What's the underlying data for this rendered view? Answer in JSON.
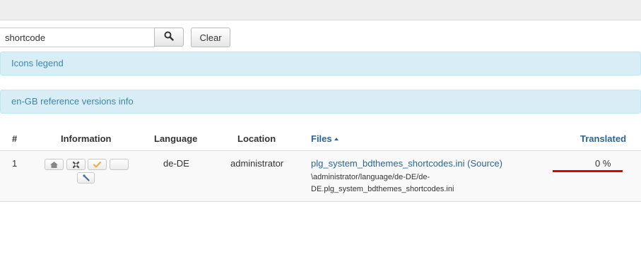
{
  "search": {
    "value": "shortcode",
    "clear_label": "Clear"
  },
  "panels": {
    "icons_legend": "Icons legend",
    "reference_info": "en-GB reference versions info"
  },
  "table": {
    "headers": {
      "number": "#",
      "information": "Information",
      "language": "Language",
      "location": "Location",
      "files": "Files",
      "translated": "Translated"
    },
    "rows": [
      {
        "number": "1",
        "language": "de-DE",
        "location": "administrator",
        "file_name": "plg_system_bdthemes_shortcodes.ini",
        "source_label": "(Source)",
        "path_line1": "\\administrator/language/de-DE/de-",
        "path_line2": "DE.plg_system_bdthemes_shortcodes.ini",
        "translated": "0 %",
        "translated_fraction": 0
      }
    ]
  },
  "icons": {
    "search": "search-icon",
    "info": [
      "home-icon",
      "joomla-icon",
      "check-icon",
      "blank-icon",
      "wrench-icon"
    ]
  },
  "colors": {
    "panel_bg": "#d9edf7",
    "panel_text": "#3a87ad",
    "link": "#2a6496",
    "check": "#f0ad4e",
    "underline": "#e00000"
  }
}
